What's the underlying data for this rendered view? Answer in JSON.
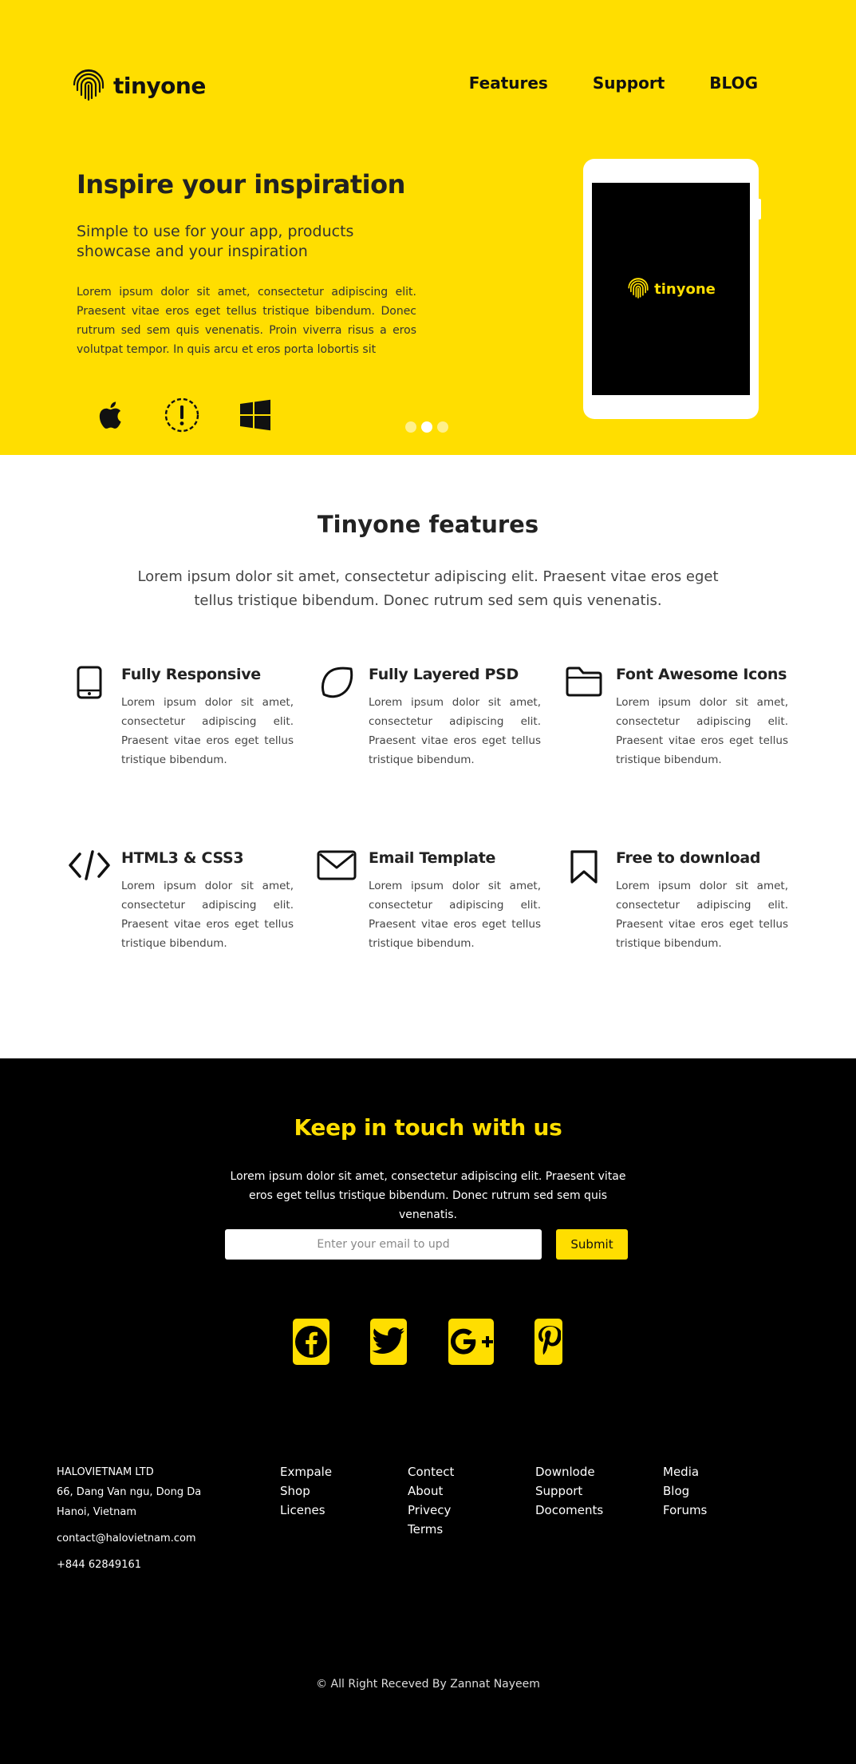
{
  "header": {
    "logo_text": "tinyone",
    "nav": [
      "Features",
      "Support",
      "BLOG"
    ]
  },
  "hero": {
    "title": "Inspire your inspiration",
    "subtitle": "Simple to use for your app, products showcase and your inspiration",
    "body": "Lorem ipsum dolor sit amet, consectetur adipiscing elit. Praesent vitae eros eget tellus tristique bibendum. Donec rutrum sed sem quis venenatis. Proin viverra risus a eros volutpat tempor. In quis arcu et eros porta lobortis sit",
    "platform_icons": [
      "apple-icon",
      "android-icon",
      "windows-icon"
    ],
    "slider_dots": 3,
    "active_dot": 2,
    "tablet_logo_text": "tinyone"
  },
  "features": {
    "title": "Tinyone features",
    "intro": "Lorem ipsum dolor sit amet, consectetur adipiscing elit. Praesent vitae eros eget tellus tristique bibendum. Donec rutrum sed sem quis venenatis.",
    "items": [
      {
        "icon": "tablet-icon",
        "title": "Fully Responsive",
        "text": "Lorem ipsum dolor sit amet, consectetur adipiscing elit. Praesent vitae eros eget tellus tristique bibendum."
      },
      {
        "icon": "leaf-icon",
        "title": "Fully Layered PSD",
        "text": "Lorem ipsum dolor sit amet, consectetur adipiscing elit. Praesent vitae eros eget tellus tristique bibendum."
      },
      {
        "icon": "folder-icon",
        "title": "Font Awesome Icons",
        "text": "Lorem ipsum dolor sit amet, consectetur adipiscing elit. Praesent vitae eros eget tellus tristique bibendum."
      },
      {
        "icon": "code-icon",
        "title": "HTML3 & CSS3",
        "text": "Lorem ipsum dolor sit amet, consectetur adipiscing elit. Praesent vitae eros eget tellus tristique bibendum."
      },
      {
        "icon": "envelope-icon",
        "title": "Email Template",
        "text": "Lorem ipsum dolor sit amet, consectetur adipiscing elit. Praesent vitae eros eget tellus tristique bibendum."
      },
      {
        "icon": "bookmark-icon",
        "title": "Free to download",
        "text": "Lorem ipsum dolor sit amet, consectetur adipiscing elit. Praesent vitae eros eget tellus tristique bibendum."
      }
    ]
  },
  "contact": {
    "title": "Keep in touch with us",
    "text": "Lorem ipsum dolor sit amet, consectetur adipiscing elit. Praesent vitae eros eget tellus tristique bibendum. Donec rutrum sed sem quis venenatis.",
    "email_placeholder": "Enter your email to upd",
    "submit_label": "Submit",
    "socials": [
      "facebook-icon",
      "twitter-icon",
      "google-plus-icon",
      "pinterest-icon"
    ]
  },
  "footer": {
    "company": {
      "name": "HALOVIETNAM LTD",
      "address1": "66, Dang Van ngu, Dong Da",
      "address2": "Hanoi, Vietnam",
      "email": "contact@halovietnam.com",
      "phone": "+844 62849161"
    },
    "columns": [
      [
        "Exmpale",
        "Shop",
        "Licenes"
      ],
      [
        "Contect",
        "About",
        "Privecy",
        "Terms"
      ],
      [
        "Downlode",
        "Support",
        "Docoments"
      ],
      [
        "Media",
        "Blog",
        "Forums"
      ]
    ],
    "copyright": "© All Right Receved By Zannat Nayeem"
  },
  "colors": {
    "accent": "#ffde00",
    "dark": "#000000",
    "text": "#222222"
  }
}
